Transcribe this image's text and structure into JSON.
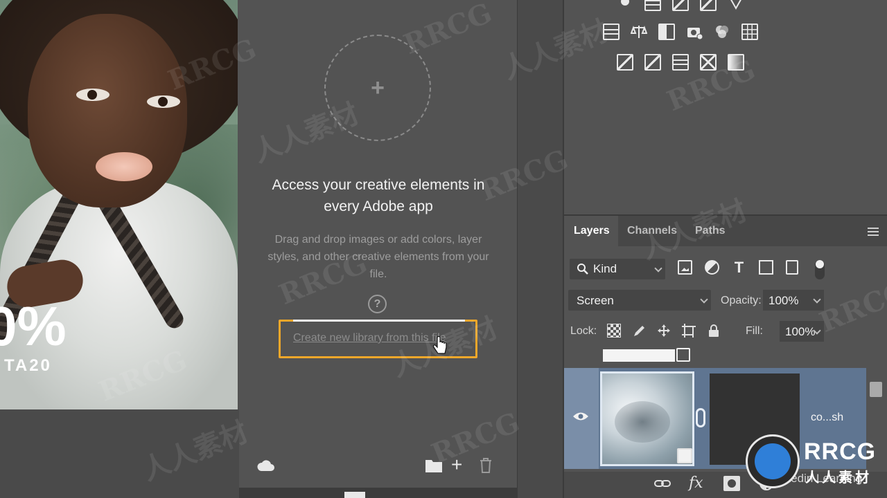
{
  "canvas": {
    "promo_percent": "0%",
    "promo_code": "TA20"
  },
  "libraries": {
    "title": "Access your creative elements in every Adobe app",
    "description": "Drag and drop images or add colors, layer styles, and other creative elements from your file.",
    "help_icon": "?",
    "create_link": "Create new library from this file",
    "add_glyph": "+",
    "plus_glyph": "+"
  },
  "layers_panel": {
    "tabs": [
      {
        "label": "Layers",
        "active": true
      },
      {
        "label": "Channels",
        "active": false
      },
      {
        "label": "Paths",
        "active": false
      }
    ],
    "filter_kind": "Kind",
    "type_filter_glyph": "T",
    "blend_mode": "Screen",
    "opacity_label": "Opacity:",
    "opacity_value": "100%",
    "lock_label": "Lock:",
    "fill_label": "Fill:",
    "fill_value": "100%",
    "selected_layer_name": "co...sh",
    "fx_label": "fx"
  },
  "watermark": {
    "brand": "RRCG",
    "cjk": "人人素材",
    "linkedin": "Linkedin Learning"
  },
  "colors": {
    "accent_highlight": "#f0a72a",
    "selected_layer": "#5f7591"
  },
  "icons": {
    "adjustments": [
      "brightness-icon",
      "levels-icon",
      "curves-icon",
      "exposure-icon",
      "vibrance-icon",
      "hue-saturation-icon",
      "color-balance-icon",
      "black-white-icon",
      "photo-filter-icon",
      "channel-mixer-icon",
      "color-lookup-icon",
      "invert-icon",
      "posterize-icon",
      "threshold-icon",
      "selective-color-icon",
      "gradient-map-icon"
    ]
  }
}
